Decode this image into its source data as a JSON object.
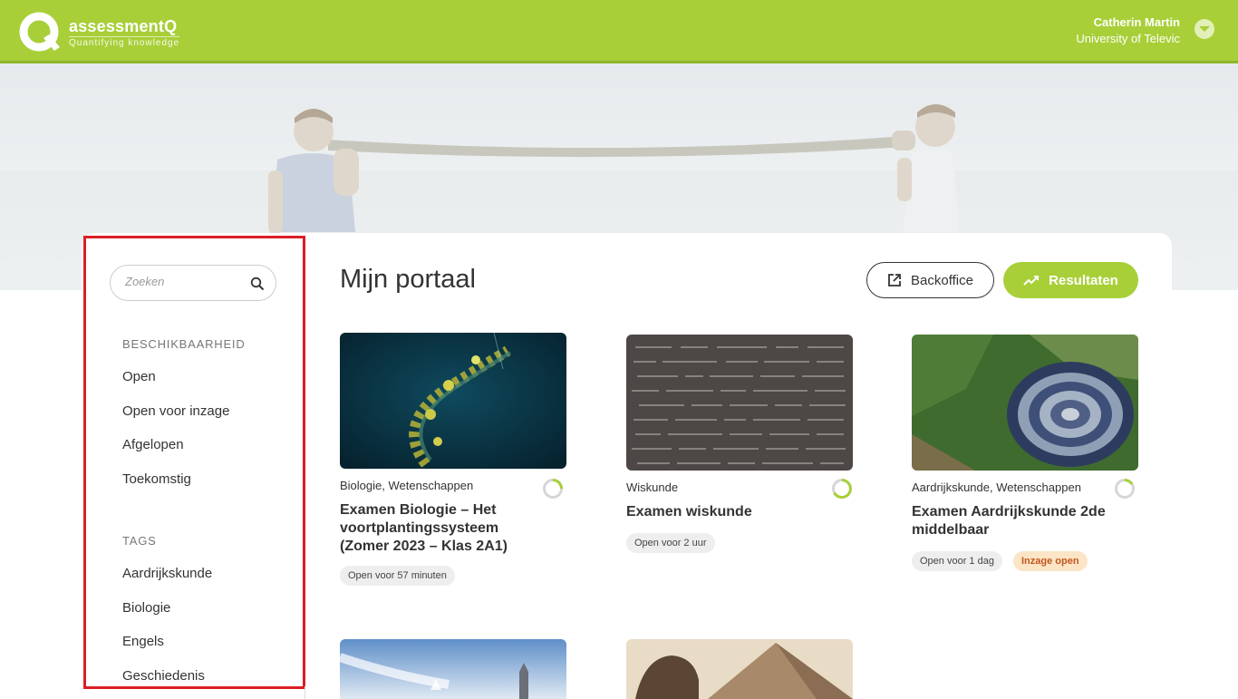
{
  "header": {
    "brand": "assessmentQ",
    "tagline": "Quantifying knowledge",
    "user_name": "Catherin Martin",
    "user_org": "University of Televic"
  },
  "sidebar": {
    "search_placeholder": "Zoeken",
    "availability_title": "BESCHIKBAARHEID",
    "availability": [
      "Open",
      "Open voor inzage",
      "Afgelopen",
      "Toekomstig"
    ],
    "tags_title": "TAGS",
    "tags": [
      "Aardrijkskunde",
      "Biologie",
      "Engels",
      "Geschiedenis"
    ]
  },
  "main": {
    "title": "Mijn portaal",
    "backoffice_label": "Backoffice",
    "results_label": "Resultaten"
  },
  "exams": [
    {
      "categories": "Biologie, Wetenschappen",
      "title_lines": [
        "Examen Biologie – Het",
        "voortplantingssysteem",
        "(Zomer 2023 – Klas 2A1)"
      ],
      "badge": "Open voor 57 minuten",
      "extra_badge": ""
    },
    {
      "categories": "Wiskunde",
      "title_lines": [
        "Examen wiskunde"
      ],
      "badge": "Open voor 2 uur",
      "extra_badge": ""
    },
    {
      "categories": "Aardrijkskunde, Wetenschappen",
      "title_lines": [
        "Examen Aardrijkskunde 2de",
        "middelbaar"
      ],
      "badge": "Open voor 1 dag",
      "extra_badge": "Inzage open"
    }
  ],
  "colors": {
    "brand_green": "#a8cf38",
    "highlight_red": "#dc1f26",
    "inzage_orange": "#c2571f"
  }
}
